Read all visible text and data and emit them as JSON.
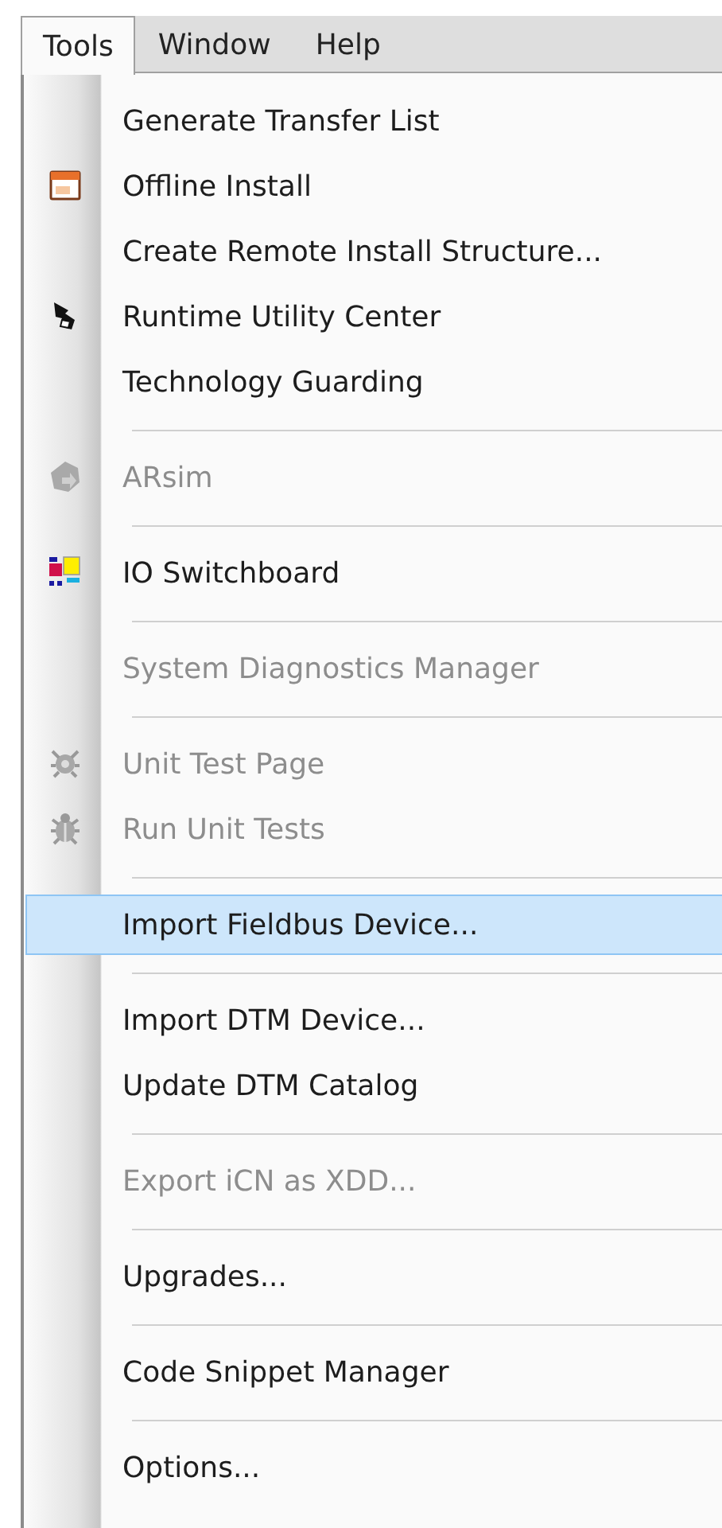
{
  "menubar": [
    {
      "label": "Tools",
      "selected": true
    },
    {
      "label": "Window",
      "selected": false
    },
    {
      "label": "Help",
      "selected": false
    }
  ],
  "menu": [
    {
      "kind": "item",
      "label": "Generate Transfer List",
      "disabled": false,
      "selected": false
    },
    {
      "kind": "item",
      "label": "Offline Install",
      "disabled": false,
      "selected": false
    },
    {
      "kind": "item",
      "label": "Create Remote Install Structure...",
      "disabled": false,
      "selected": false
    },
    {
      "kind": "item",
      "label": "Runtime Utility Center",
      "disabled": false,
      "selected": false
    },
    {
      "kind": "item",
      "label": "Technology Guarding",
      "disabled": false,
      "selected": false
    },
    {
      "kind": "separator"
    },
    {
      "kind": "item",
      "label": "ARsim",
      "disabled": true,
      "selected": false
    },
    {
      "kind": "separator"
    },
    {
      "kind": "item",
      "label": "IO Switchboard",
      "disabled": false,
      "selected": false
    },
    {
      "kind": "separator"
    },
    {
      "kind": "item",
      "label": "System Diagnostics Manager",
      "disabled": true,
      "selected": false
    },
    {
      "kind": "separator"
    },
    {
      "kind": "item",
      "label": "Unit Test Page",
      "disabled": true,
      "selected": false
    },
    {
      "kind": "item",
      "label": "Run Unit Tests",
      "disabled": true,
      "selected": false
    },
    {
      "kind": "separator"
    },
    {
      "kind": "item",
      "label": "Import Fieldbus Device...",
      "disabled": false,
      "selected": true
    },
    {
      "kind": "separator"
    },
    {
      "kind": "item",
      "label": "Import DTM Device...",
      "disabled": false,
      "selected": false
    },
    {
      "kind": "item",
      "label": "Update DTM Catalog",
      "disabled": false,
      "selected": false
    },
    {
      "kind": "separator"
    },
    {
      "kind": "item",
      "label": "Export iCN as XDD...",
      "disabled": true,
      "selected": false
    },
    {
      "kind": "separator"
    },
    {
      "kind": "item",
      "label": "Upgrades...",
      "disabled": false,
      "selected": false
    },
    {
      "kind": "separator"
    },
    {
      "kind": "item",
      "label": "Code Snippet Manager",
      "disabled": false,
      "selected": false
    },
    {
      "kind": "separator"
    },
    {
      "kind": "item",
      "label": "Options...",
      "disabled": false,
      "selected": false
    }
  ]
}
